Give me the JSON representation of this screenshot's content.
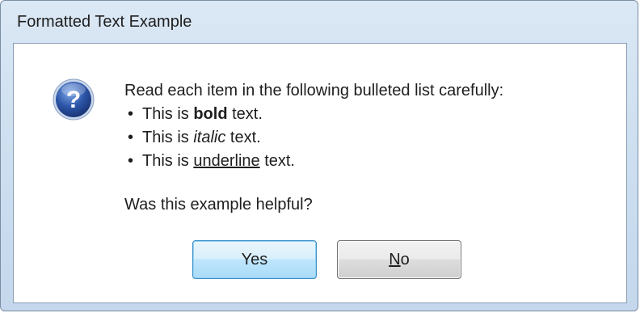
{
  "window": {
    "title": "Formatted Text Example"
  },
  "dialog": {
    "icon": "question-icon",
    "intro": "Read each item in the following bulleted list carefully:",
    "items": [
      {
        "prefix": "This is ",
        "emphasis": "bold",
        "suffix": " text.",
        "style": "bold"
      },
      {
        "prefix": "This is ",
        "emphasis": "italic",
        "suffix": " text.",
        "style": "italic"
      },
      {
        "prefix": "This is ",
        "emphasis": "underline",
        "suffix": " text.",
        "style": "underline"
      }
    ],
    "question": "Was this example helpful?"
  },
  "buttons": {
    "yes_label": "Yes",
    "no_mnemonic": "N",
    "no_rest": "o"
  },
  "colors": {
    "icon_blue": "#2c55a8",
    "default_button_border": "#3c8fc7"
  }
}
